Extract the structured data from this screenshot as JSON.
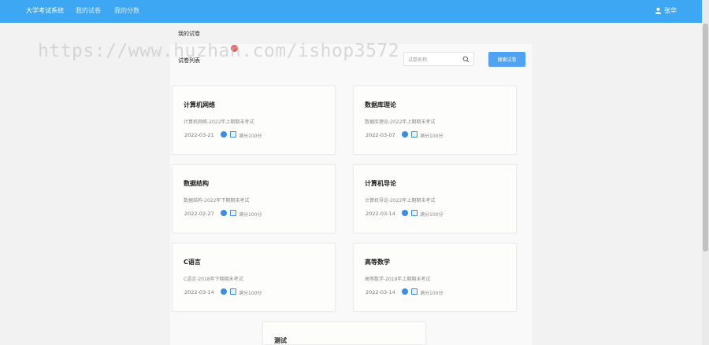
{
  "header": {
    "brand": "大学考试系统",
    "nav": [
      "我的试卷",
      "我的分数"
    ],
    "user_name": "张华"
  },
  "page_title": "我的试卷",
  "watermark": "https://www.huzhan.com/ishop3572",
  "tabs": [
    "试卷列表",
    "",
    ""
  ],
  "search": {
    "placeholder": "试卷名称",
    "button_label": "搜索试卷"
  },
  "cards": [
    {
      "title": "计算机网络",
      "desc": "计算机网络-2022年上期期末考试",
      "date": "2022-03-21",
      "score": "满分100分"
    },
    {
      "title": "数据库理论",
      "desc": "数据库理论-2022年上期期末考试",
      "date": "2022-03-07",
      "score": "满分100分"
    },
    {
      "title": "数据结构",
      "desc": "数据结构-2022年下期期末考试",
      "date": "2022-02-27",
      "score": "满分100分"
    },
    {
      "title": "计算机导论",
      "desc": "计算机导论-2022年上期期末考试",
      "date": "2022-03-14",
      "score": "满分100分"
    },
    {
      "title": "C语言",
      "desc": "C语言-2018年下期期末考试",
      "date": "2022-03-14",
      "score": "满分100分"
    },
    {
      "title": "高等数学",
      "desc": "高等数学-2018年上期期末考试",
      "date": "2022-03-14",
      "score": "满分100分"
    },
    {
      "title": "测试",
      "desc": "",
      "date": "",
      "score": ""
    }
  ],
  "colors": {
    "navbar": "#3ea7f4",
    "accent": "#4fa3f2",
    "badge": "#e86060"
  },
  "icons": [
    "user-icon",
    "search-icon",
    "clock-icon",
    "edit-icon"
  ]
}
